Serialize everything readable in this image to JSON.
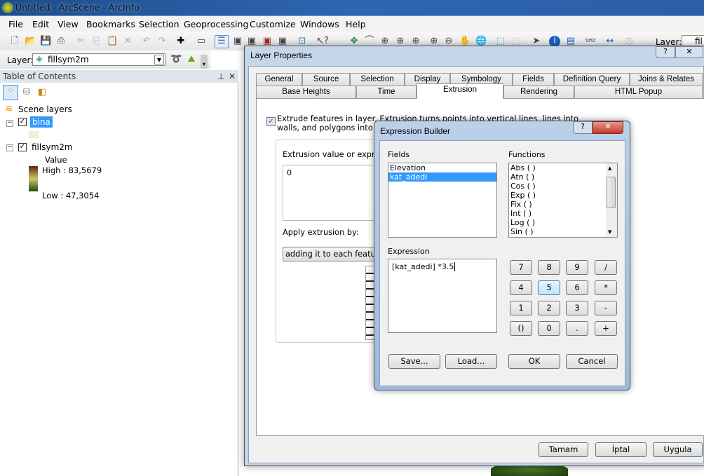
{
  "window": {
    "title": "Untitled - ArcScene - ArcInfo"
  },
  "menu": [
    "File",
    "Edit",
    "View",
    "Bookmarks",
    "Selection",
    "Geoprocessing",
    "Customize",
    "Windows",
    "Help"
  ],
  "layer_toolbar": {
    "label": "Layer:",
    "value": "fillsym2m",
    "right_label": "Layer:",
    "right_value": "fil"
  },
  "toc": {
    "title": "Table of Contents",
    "root": "Scene layers",
    "layers": [
      {
        "name": "bina",
        "checked": true,
        "selected": true,
        "swatch": "#e6f5d6"
      },
      {
        "name": "fillsym2m",
        "checked": true,
        "legend_title": "Value",
        "high": "High : 83,5679",
        "low": "Low : 47,3054"
      }
    ]
  },
  "layer_properties": {
    "title": "Layer Properties",
    "tabs_row1": [
      "General",
      "Source",
      "Selection",
      "Display",
      "Symbology",
      "Fields",
      "Definition Query",
      "Joins & Relates"
    ],
    "tabs_row2": [
      "Base Heights",
      "Time",
      "Extrusion",
      "Rendering",
      "HTML Popup"
    ],
    "active_tab": "Extrusion",
    "extrude_checked": true,
    "extrude_text_1": "Extrude features in layer.  Extrusion turns points into vertical lines, lines into",
    "extrude_text_2": "walls, and polygons into block",
    "expr_label": "Extrusion value or expressio",
    "expr_value": "0",
    "apply_label": "Apply extrusion by:",
    "apply_value": "adding it to each feature's m",
    "buttons": {
      "ok": "Tamam",
      "cancel": "İptal",
      "apply": "Uygula"
    }
  },
  "expression_builder": {
    "title": "Expression Builder",
    "fields_label": "Fields",
    "fields": [
      "Elevation",
      "kat_adedi"
    ],
    "selected_field": "kat_adedi",
    "functions_label": "Functions",
    "functions": [
      "Abs ( )",
      "Atn ( )",
      "Cos ( )",
      "Exp ( )",
      "Fix ( )",
      "Int ( )",
      "Log ( )",
      "Sin ( )"
    ],
    "expression_label": "Expression",
    "expression": "[kat_adedi] *3.5",
    "keys": [
      "7",
      "8",
      "9",
      "/",
      "4",
      "5",
      "6",
      "*",
      "1",
      "2",
      "3",
      "-",
      "()",
      "0",
      ".",
      "+"
    ],
    "focused_key": "5",
    "save": "Save...",
    "load": "Load...",
    "ok": "OK",
    "cancel": "Cancel"
  }
}
